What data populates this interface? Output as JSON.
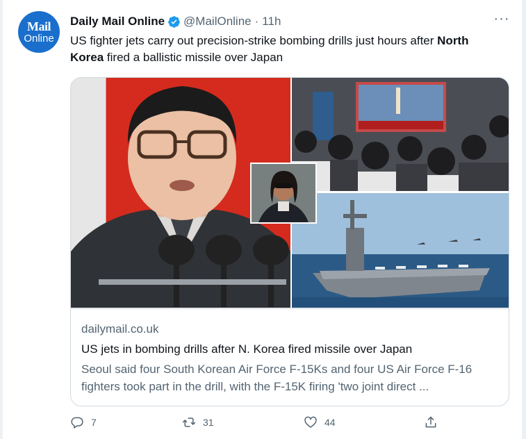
{
  "tweet": {
    "avatar": {
      "line1": "Mail",
      "line2": "Online"
    },
    "author_name": "Daily Mail Online",
    "handle": "@MailOnline",
    "separator": "·",
    "time": "11h",
    "more_label": "···",
    "text_part1": "US fighter jets carry out precision-strike bombing drills just hours after ",
    "text_bold": "North Korea",
    "text_part2": " fired a ballistic missile over Japan"
  },
  "card": {
    "images": [
      {
        "icon": "kim-jong-un-photo"
      },
      {
        "icon": "tv-news-crowd-photo"
      },
      {
        "icon": "aircraft-carrier-photo"
      },
      {
        "icon": "kamala-harris-inset-photo"
      }
    ],
    "domain": "dailymail.co.uk",
    "title": "US jets in bombing drills after N. Korea fired missile over Japan",
    "description": "Seoul said four South Korean Air Force F-15Ks and four US Air Force F-16 fighters took part in the drill, with the F-15K firing 'two joint direct ..."
  },
  "actions": {
    "reply_count": "7",
    "retweet_count": "31",
    "like_count": "44"
  },
  "colors": {
    "brand_blue": "#1a6fcc",
    "verified": "#1d9bf0",
    "muted": "#536471",
    "text": "#0f1419",
    "border": "#cfd9de"
  }
}
